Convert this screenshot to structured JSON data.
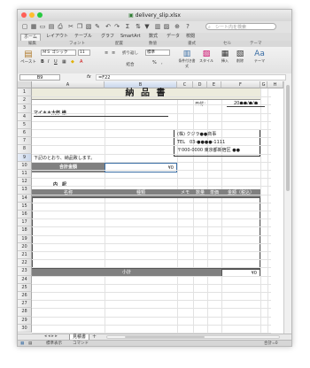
{
  "window": {
    "title": "delivery_slip.xlsx"
  },
  "search": {
    "placeholder": "シート内を検索"
  },
  "tabs": [
    "ホーム",
    "レイアウト",
    "テーブル",
    "グラフ",
    "SmartArt",
    "数式",
    "データ",
    "校閲"
  ],
  "ribbon": {
    "groups": [
      "編集",
      "フォント",
      "配置",
      "数値",
      "書式",
      "セル",
      "テーマ"
    ],
    "font_name": "ＭＳ ゴシック",
    "font_size": "11",
    "number_format": "標準",
    "paste_label": "ペースト",
    "wrap_label": "折り返し",
    "merge_label": "結合",
    "conditional_label": "条件付き書式",
    "styles_label": "スタイル",
    "insert_label": "挿入",
    "delete_label": "削除",
    "format_label": "書式",
    "theme_label": "テーマ"
  },
  "formula_bar": {
    "name_box": "B9",
    "fx": "fx",
    "formula": "=F22"
  },
  "columns": [
    "A",
    "B",
    "C",
    "D",
    "E",
    "F",
    "G",
    "H"
  ],
  "rows": [
    "1",
    "2",
    "3",
    "4",
    "5",
    "6",
    "7",
    "8",
    "9",
    "10",
    "11",
    "12",
    "13",
    "14",
    "15",
    "16",
    "17",
    "18",
    "19",
    "20",
    "21",
    "22",
    "23",
    "24",
    "25",
    "26",
    "27",
    "28",
    "29",
    "30"
  ],
  "sheet": {
    "title": "納 品 書",
    "date_label": "日付：",
    "date_value": "20●●/●/●",
    "recipient": "マイ＊＊太郎 様",
    "company": "(株) クジラ●●商事",
    "tel": "TEL　03-●●●●-1111",
    "address": "〒000-0000 東京都新宿区 ●●",
    "notice": "下記のとおり、納品致します。",
    "total_label": "合計金額",
    "total_value": "¥0",
    "items_label": "内　訳",
    "table_headers": [
      "名称",
      "種類",
      "メモ",
      "数量",
      "単価",
      "金額（税込）"
    ],
    "subtotal_label": "小計",
    "subtotal_value": "¥0"
  },
  "sheet_tabs": [
    "見積書",
    "+"
  ],
  "status": {
    "mode": "標準表示",
    "ready": "コマンド",
    "sum": "合計=0"
  },
  "colors": {
    "accent": "#3a6ea5",
    "header_gray": "#808080",
    "title_bg": "#e8e8d8"
  }
}
